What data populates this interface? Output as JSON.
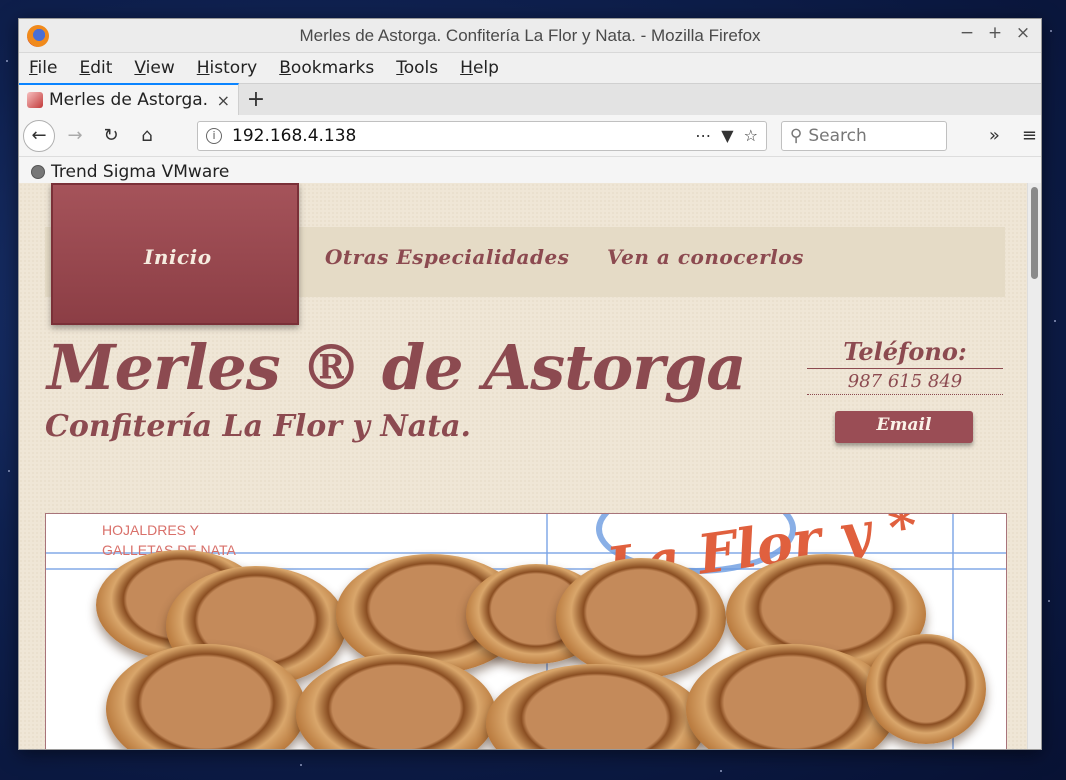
{
  "window": {
    "title": "Merles de Astorga. Confitería La Flor y Nata. - Mozilla Firefox",
    "controls": {
      "minimize": "−",
      "maximize": "+",
      "close": "×"
    }
  },
  "menubar": [
    "File",
    "Edit",
    "View",
    "History",
    "Bookmarks",
    "Tools",
    "Help"
  ],
  "tab": {
    "title": "Merles de Astorga. Confitería La Flor y Nata.",
    "close": "×",
    "new_tab": "+"
  },
  "navbar": {
    "url": "192.168.4.138",
    "search_placeholder": "Search",
    "icons": [
      "back-icon",
      "forward-icon",
      "reload-icon",
      "home-icon",
      "info-icon",
      "more-actions-icon",
      "pocket-icon",
      "bookmark-star-icon",
      "search-icon",
      "overflow-icon",
      "hamburger-menu-icon"
    ]
  },
  "bookmarks": {
    "items": [
      "Trend Sigma VMware"
    ]
  },
  "site": {
    "nav": [
      "Inicio",
      "Otras Especialidades",
      "Ven a conocerlos"
    ],
    "title": "Merles ®  de Astorga",
    "subtitle": "Confitería La Flor y Nata.",
    "phone_label": "Teléfono:",
    "phone_number": "987 615 849",
    "email_button": "Email",
    "hero_caption": "HOJALDRES Y\nGALLETAS DE NATA",
    "hero_brand": "La Flor y",
    "hero_brand_mark": "*"
  },
  "colors": {
    "brand": "#8c4a50",
    "page_bg": "#efe6d6",
    "nav_strip": "#e5dbc6",
    "accent_tab": "#0a84ff"
  }
}
